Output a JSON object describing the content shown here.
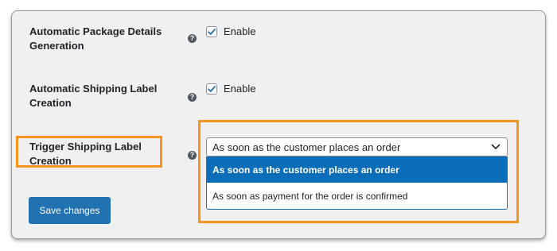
{
  "settings": {
    "package_details": {
      "label": "Automatic Package Details Generation",
      "help_glyph": "?",
      "checkbox_label": "Enable",
      "checked": true
    },
    "shipping_label": {
      "label": "Automatic Shipping Label Creation",
      "help_glyph": "?",
      "checkbox_label": "Enable",
      "checked": true
    },
    "trigger": {
      "label": "Trigger Shipping Label Creation",
      "help_glyph": "?",
      "selected_value": "As soon as the customer places an order",
      "options": [
        "As soon as the customer places an order",
        "As soon as payment for the order is confirmed"
      ]
    }
  },
  "save_button": {
    "label": "Save changes"
  },
  "colors": {
    "accent": "#2271b1",
    "selected_option": "#0b6db8",
    "highlight": "#f7941d",
    "panel_bg": "#f0f0f1"
  },
  "icons": {
    "help": "question-circle-icon",
    "check": "checkmark-icon",
    "dropdown": "chevron-down-icon"
  }
}
